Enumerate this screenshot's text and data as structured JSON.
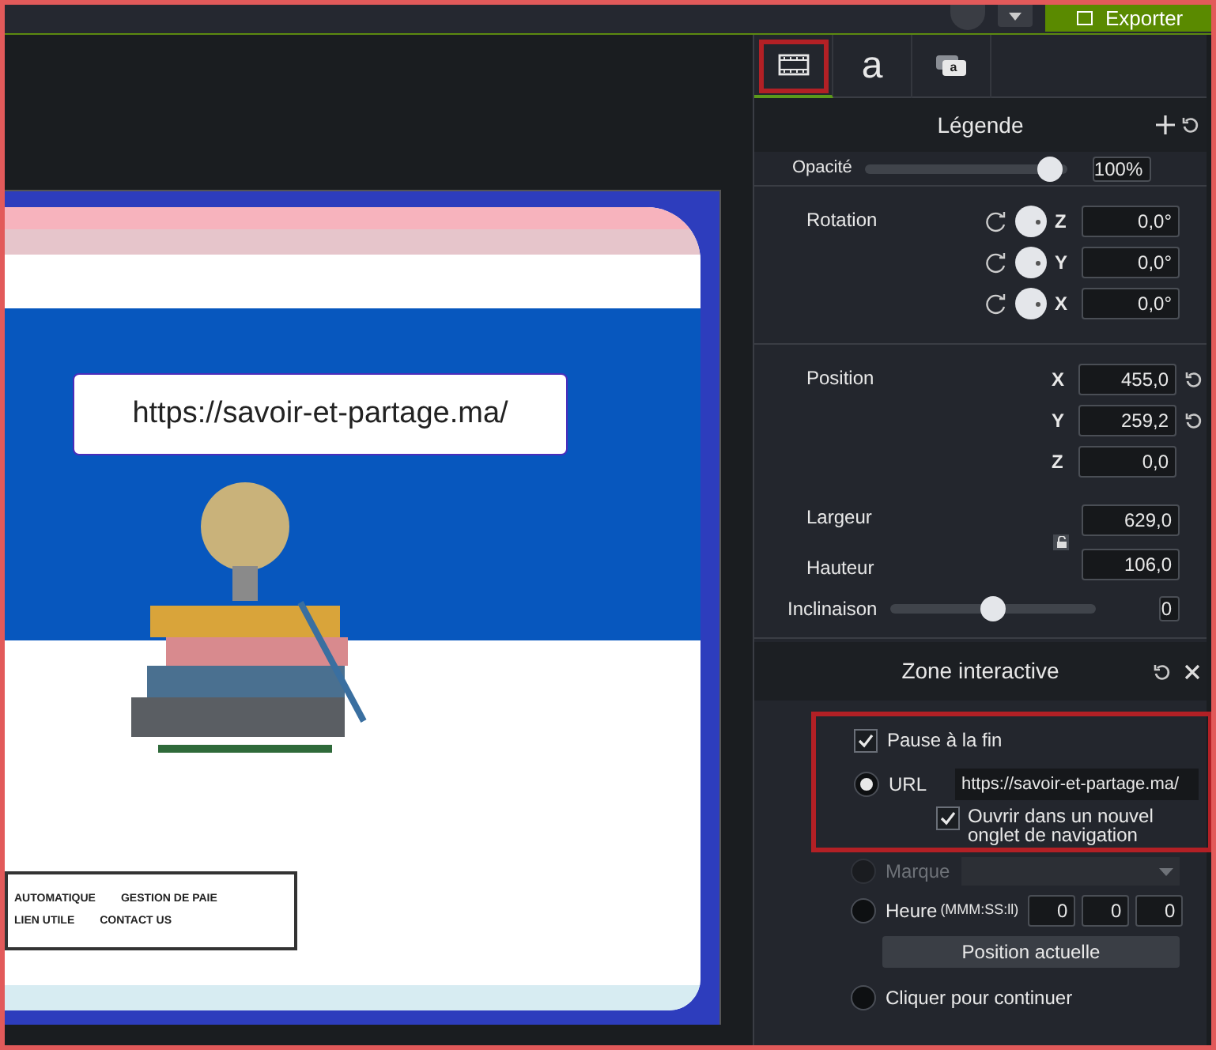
{
  "top_bar": {
    "export_button": "Exporter"
  },
  "canvas": {
    "callout": "https://savoir-et-partage.ma/",
    "nav_links": [
      "AUTOMATIQUE",
      "GESTION DE PAIE",
      "LIEN UTILE",
      "CONTACT US"
    ]
  },
  "properties": {
    "tabs": [
      {
        "kind": "video",
        "selected": true,
        "highlighted": true
      },
      {
        "kind": "text",
        "label": "a",
        "selected": false,
        "highlighted": false
      },
      {
        "kind": "callout",
        "label": "a",
        "selected": false,
        "highlighted": false
      }
    ],
    "title": "Légende",
    "opacity": {
      "label": "Opacité",
      "level": 0.97,
      "value": "100%"
    },
    "rotation": {
      "label": "Rotation",
      "axes": [
        {
          "axis": "Z",
          "value": "0,0°"
        },
        {
          "axis": "Y",
          "value": "0,0°"
        },
        {
          "axis": "X",
          "value": "0,0°"
        }
      ]
    },
    "position": {
      "label": "Position",
      "axes": [
        {
          "axis": "X",
          "value": "455,0",
          "reset": true
        },
        {
          "axis": "Y",
          "value": "259,2",
          "reset": true
        },
        {
          "axis": "Z",
          "value": "0,0",
          "reset": false
        }
      ]
    },
    "width": {
      "label": "Largeur",
      "value": "629,0"
    },
    "height": {
      "label": "Hauteur",
      "value": "106,0"
    },
    "locked": false,
    "skew": {
      "label": "Inclinaison",
      "level": 0.5,
      "value": "0"
    }
  },
  "hotspot": {
    "title": "Zone interactive",
    "pause": {
      "label": "Pause à la fin",
      "checked": true
    },
    "actions": [
      {
        "kind": "url",
        "label": "URL",
        "selected": true,
        "disabled": false,
        "value": "https://savoir-et-partage.ma/",
        "new_tab": {
          "label": "Ouvrir dans un nouvel onglet de navigation",
          "checked": true
        }
      },
      {
        "kind": "marker",
        "label": "Marque",
        "selected": false,
        "disabled": true
      },
      {
        "kind": "time",
        "label": "Heure",
        "hint": "(MMM:SS:ll)",
        "selected": false,
        "disabled": false,
        "fields": [
          "0",
          "0",
          "0"
        ],
        "button": "Position actuelle"
      },
      {
        "kind": "click",
        "label": "Cliquer pour continuer",
        "selected": false,
        "disabled": false
      }
    ]
  }
}
